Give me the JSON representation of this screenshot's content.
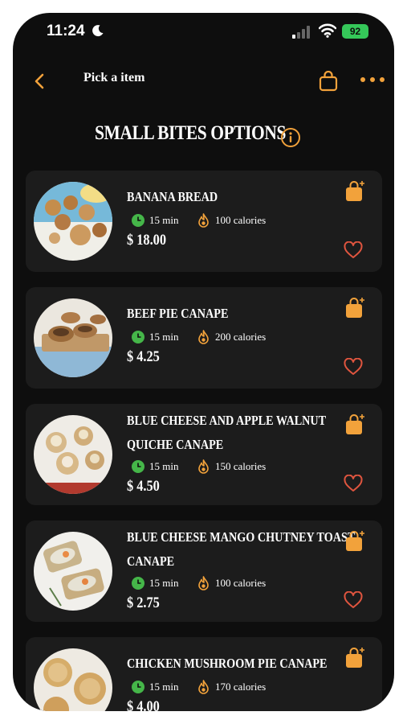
{
  "status": {
    "time": "11:24",
    "battery": "92"
  },
  "nav": {
    "title": "Pick a item"
  },
  "page": {
    "heading": "SMALL BITES OPTIONS"
  },
  "items": [
    {
      "title_lines": [
        "BANANA BREAD"
      ],
      "minutes": "15 min",
      "calories": "100 calories",
      "price": "$ 18.00"
    },
    {
      "title_lines": [
        "BEEF PIE CANAPE"
      ],
      "minutes": "15 min",
      "calories": "200 calories",
      "price": "$ 4.25"
    },
    {
      "title_lines": [
        "BLUE CHEESE AND APPLE WALNUT",
        "QUICHE  CANAPE"
      ],
      "minutes": "15 min",
      "calories": "150 calories",
      "price": "$ 4.50"
    },
    {
      "title_lines": [
        "BLUE CHEESE MANGO CHUTNEY TOAST",
        "CANAPE"
      ],
      "minutes": "15 min",
      "calories": "100 calories",
      "price": "$ 2.75"
    },
    {
      "title_lines": [
        "CHICKEN MUSHROOM PIE  CANAPE"
      ],
      "minutes": "15 min",
      "calories": "170 calories",
      "price": "$ 4.00"
    }
  ],
  "colors": {
    "accent": "#f2a23b",
    "heart": "#e0553f",
    "clock": "#45b649",
    "card": "#1c1c1c",
    "background": "#0e0e0e"
  },
  "icons": [
    "back-chevron-icon",
    "shopping-bag-icon",
    "more-dots-icon",
    "info-icon",
    "clock-icon",
    "flame-icon",
    "add-to-bag-icon",
    "heart-icon",
    "moon-icon",
    "signal-icon",
    "wifi-icon",
    "battery-icon"
  ]
}
